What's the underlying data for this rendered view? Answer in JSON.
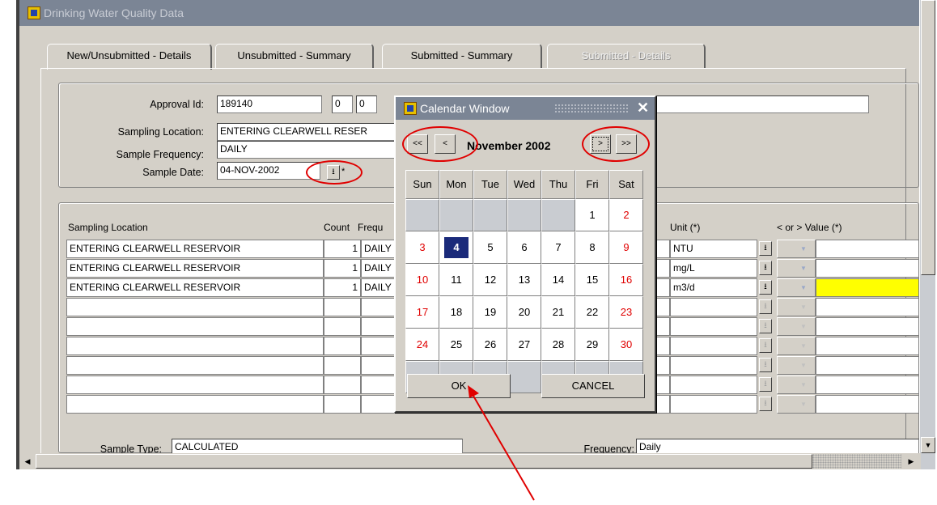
{
  "window": {
    "title": "Drinking Water Quality Data"
  },
  "tabs": [
    {
      "label": "New/Unsubmitted - Details",
      "state": "active"
    },
    {
      "label": "Unsubmitted - Summary",
      "state": "normal"
    },
    {
      "label": "Submitted - Summary",
      "state": "normal"
    },
    {
      "label": "Submitted - Details",
      "state": "disabled"
    }
  ],
  "header_form": {
    "approval_label": "Approval Id:",
    "approval_value": "189140",
    "approval_sub1": "0",
    "approval_sub2": "0",
    "location_label": "Sampling Location:",
    "location_value": "ENTERING CLEARWELL RESER",
    "frequency_label": "Sample Frequency:",
    "frequency_value": "DAILY",
    "date_label": "Sample Date:",
    "date_value": "04-NOV-2002",
    "required_mark": "*"
  },
  "table": {
    "col_location": "Sampling Location",
    "col_count": "Count",
    "col_frequency": "Frequ",
    "col_unit": "Unit (*)",
    "col_value": "< or > Value (*)",
    "rows": [
      {
        "location": "ENTERING CLEARWELL RESERVOIR",
        "count": "1",
        "frequency": "DAILY",
        "unit": "NTU"
      },
      {
        "location": "ENTERING CLEARWELL RESERVOIR",
        "count": "1",
        "frequency": "DAILY",
        "unit": "mg/L"
      },
      {
        "location": "ENTERING CLEARWELL RESERVOIR",
        "count": "1",
        "frequency": "DAILY",
        "unit": "m3/d"
      }
    ]
  },
  "footer": {
    "sample_type_label": "Sample Type:",
    "sample_type_value": "CALCULATED",
    "frequency_label": "Frequency:",
    "frequency_value": "Daily"
  },
  "calendar": {
    "title": "Calendar Window",
    "month_label": "November 2002",
    "prev_year": "<<",
    "prev_month": "<",
    "next_month": ">",
    "next_year": ">>",
    "weekdays": [
      "Sun",
      "Mon",
      "Tue",
      "Wed",
      "Thu",
      "Fri",
      "Sat"
    ],
    "selected_day": "4",
    "weeks": [
      [
        "",
        "",
        "",
        "",
        "",
        "1",
        "2"
      ],
      [
        "3",
        "4",
        "5",
        "6",
        "7",
        "8",
        "9"
      ],
      [
        "10",
        "11",
        "12",
        "13",
        "14",
        "15",
        "16"
      ],
      [
        "17",
        "18",
        "19",
        "20",
        "21",
        "22",
        "23"
      ],
      [
        "24",
        "25",
        "26",
        "27",
        "28",
        "29",
        "30"
      ],
      [
        "",
        "",
        "",
        "",
        "",
        "",
        ""
      ]
    ],
    "ok_label": "OK",
    "cancel_label": "CANCEL"
  },
  "colors": {
    "titlebar": "#7b8595",
    "highlight": "#ffff00",
    "annotation": "#e00000",
    "selected_day": "#1a2a7a"
  }
}
